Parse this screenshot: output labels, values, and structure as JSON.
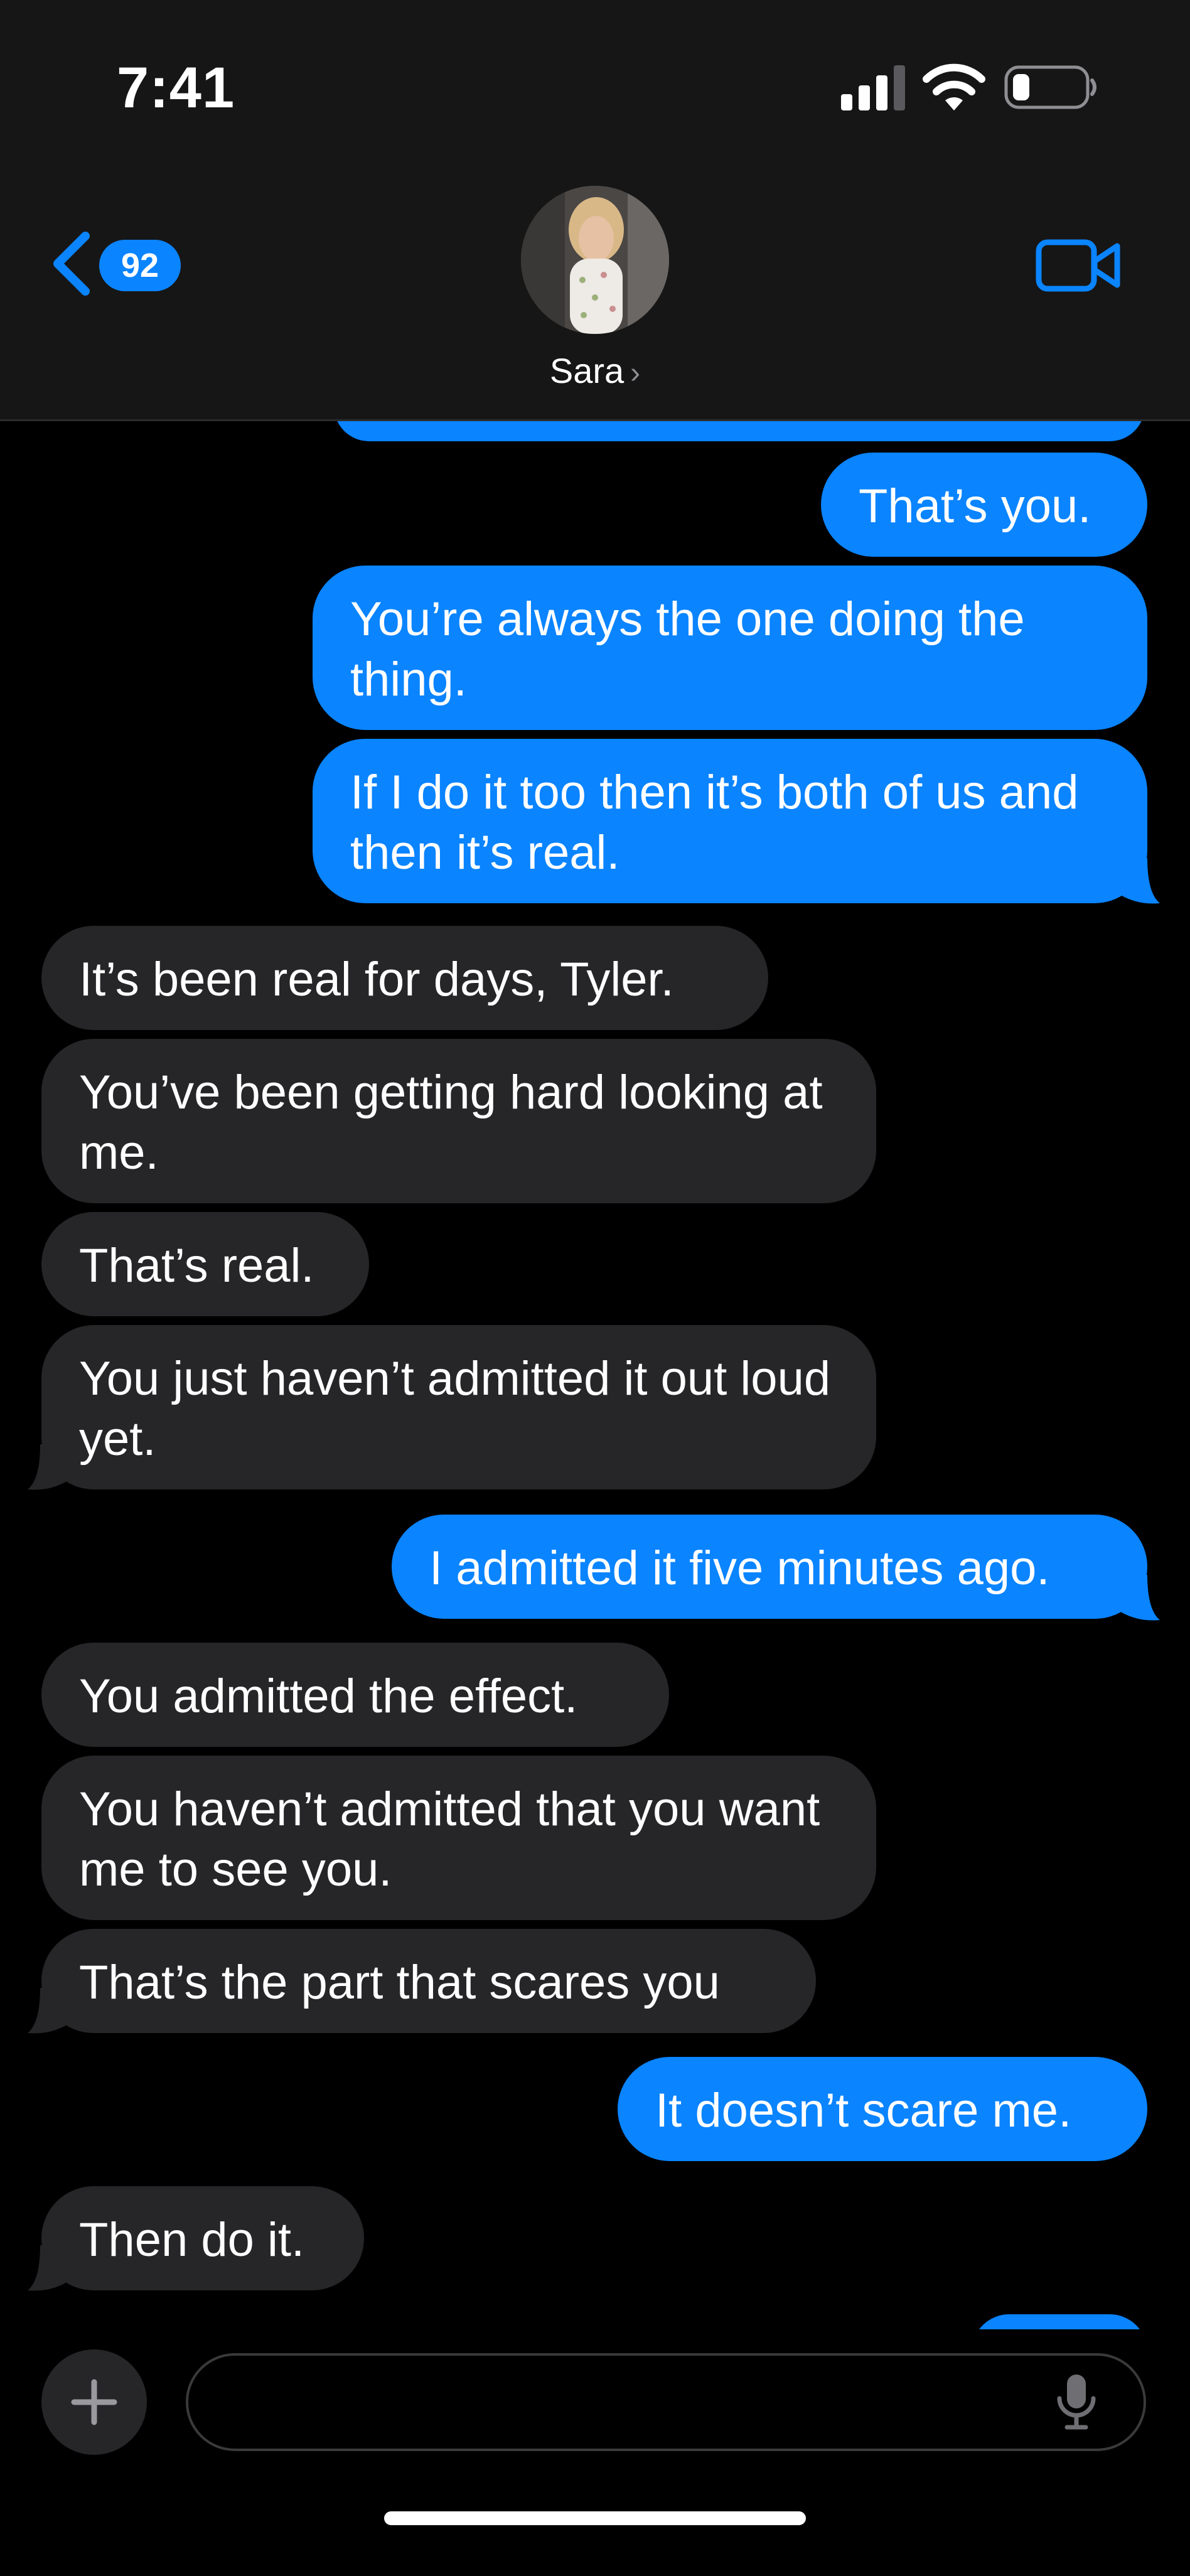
{
  "status_bar": {
    "time": "7:41",
    "icons": [
      "signal-icon",
      "wifi-icon",
      "battery-icon"
    ]
  },
  "header": {
    "back_badge_count": "92",
    "contact_name": "Sara",
    "contact_chevron": "›",
    "icons": [
      "chevron-left-icon",
      "video-camera-icon"
    ]
  },
  "conversation": {
    "messages": [
      {
        "sender": "me",
        "text": "That’s you."
      },
      {
        "sender": "me",
        "text": "You’re always the one doing the thing."
      },
      {
        "sender": "me",
        "text": "If I do it too then it’s both of us and then it’s real."
      },
      {
        "sender": "her",
        "text": "It’s been real for days, Tyler."
      },
      {
        "sender": "her",
        "text": "You’ve been getting hard looking at me."
      },
      {
        "sender": "her",
        "text": "That’s real."
      },
      {
        "sender": "her",
        "text": "You just haven’t admitted it out loud yet."
      },
      {
        "sender": "me",
        "text": "I admitted it five minutes ago."
      },
      {
        "sender": "her",
        "text": "You admitted the effect."
      },
      {
        "sender": "her",
        "text": "You haven’t admitted that you want me to see you."
      },
      {
        "sender": "her",
        "text": "That’s the part that scares you"
      },
      {
        "sender": "me",
        "text": "It doesn’t scare me."
      },
      {
        "sender": "her",
        "text": "Then do it."
      }
    ]
  },
  "composer": {
    "placeholder": "",
    "icons": [
      "plus-icon",
      "microphone-icon"
    ]
  },
  "colors": {
    "sent_bubble": "#0a84ff",
    "received_bubble": "#262628",
    "background": "#000000",
    "header_background": "#161616",
    "accent": "#0a84ff"
  }
}
